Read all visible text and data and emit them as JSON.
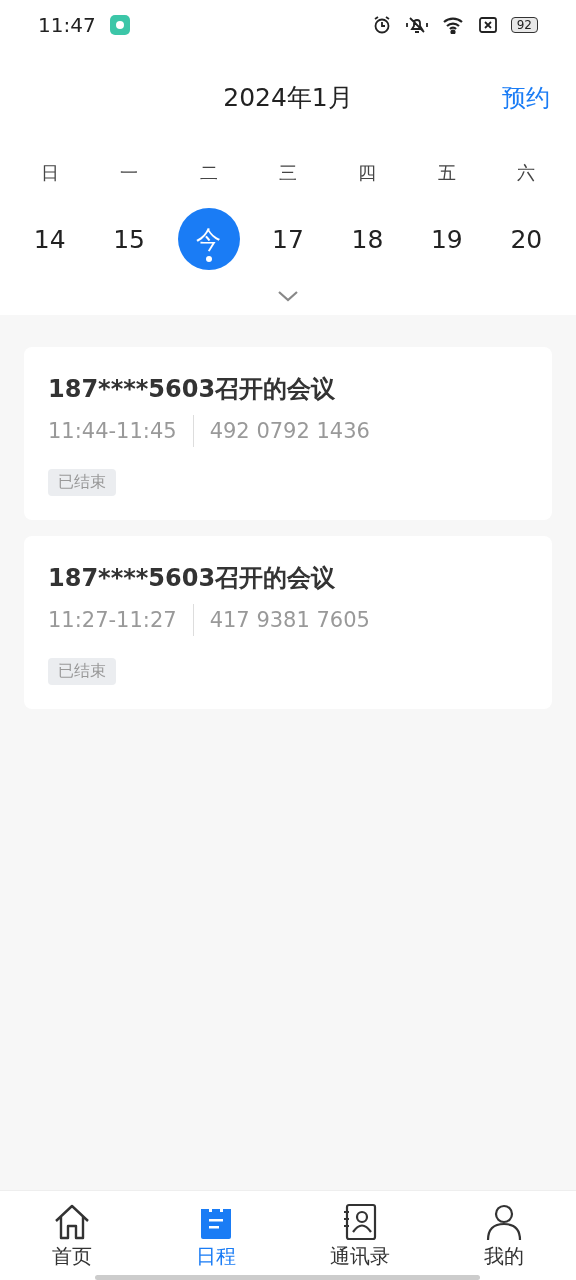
{
  "status_bar": {
    "time": "11:47",
    "battery": "92"
  },
  "header": {
    "title": "2024年1月",
    "action": "预约"
  },
  "weekdays": [
    "日",
    "一",
    "二",
    "三",
    "四",
    "五",
    "六"
  ],
  "days": [
    {
      "label": "14",
      "selected": false
    },
    {
      "label": "15",
      "selected": false
    },
    {
      "label": "今",
      "selected": true
    },
    {
      "label": "17",
      "selected": false
    },
    {
      "label": "18",
      "selected": false
    },
    {
      "label": "19",
      "selected": false
    },
    {
      "label": "20",
      "selected": false
    }
  ],
  "meetings": [
    {
      "title": "187****5603召开的会议",
      "time": "11:44-11:45",
      "meeting_id": "492 0792 1436",
      "status": "已结束"
    },
    {
      "title": "187****5603召开的会议",
      "time": "11:27-11:27",
      "meeting_id": "417 9381 7605",
      "status": "已结束"
    }
  ],
  "tabs": [
    {
      "label": "首页",
      "kind": "home",
      "selected": false
    },
    {
      "label": "日程",
      "kind": "calendar",
      "selected": true
    },
    {
      "label": "通讯录",
      "kind": "contacts",
      "selected": false
    },
    {
      "label": "我的",
      "kind": "person",
      "selected": false
    }
  ]
}
